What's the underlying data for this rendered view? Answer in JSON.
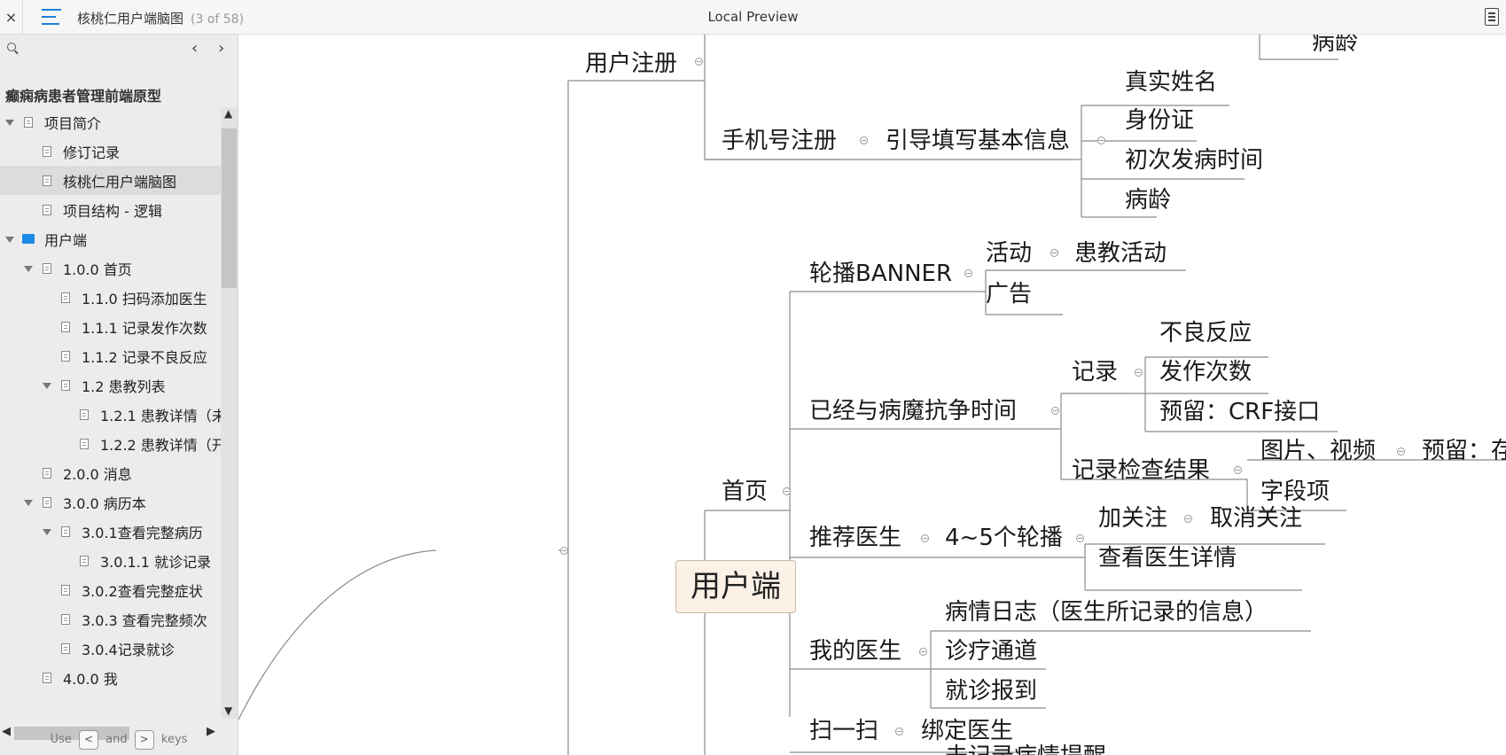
{
  "topbar": {
    "close_glyph": "×",
    "doc_title": "核桃仁用户端脑图",
    "doc_count": "(3 of 58)",
    "center_title": "Local Preview",
    "icons": [
      "close-icon",
      "toc-icon",
      "outline-icon"
    ]
  },
  "sidebar": {
    "project_title": "癫痫病患者管理前端原型",
    "nav_prev": "‹",
    "nav_next": "›",
    "items": [
      {
        "label": "项目简介"
      },
      {
        "label": "修订记录"
      },
      {
        "label": "核桃仁用户端脑图"
      },
      {
        "label": "项目结构 - 逻辑"
      },
      {
        "label": "用户端"
      },
      {
        "label": "1.0.0 首页"
      },
      {
        "label": "1.1.0 扫码添加医生"
      },
      {
        "label": "1.1.1 记录发作次数"
      },
      {
        "label": "1.1.2 记录不良反应"
      },
      {
        "label": "1.2 患教列表"
      },
      {
        "label": "1.2.1 患教详情（未"
      },
      {
        "label": "1.2.2 患教详情（开"
      },
      {
        "label": "2.0.0 消息"
      },
      {
        "label": "3.0.0 病历本"
      },
      {
        "label": "3.0.1查看完整病历"
      },
      {
        "label": "3.0.1.1 就诊记录"
      },
      {
        "label": "3.0.2查看完整症状"
      },
      {
        "label": "3.0.3 查看完整频次"
      },
      {
        "label": "3.0.4记录就诊"
      },
      {
        "label": "4.0.0 我"
      }
    ],
    "hint_use": "Use",
    "hint_and": "and",
    "hint_keys": "keys",
    "key_left": "<",
    "key_right": ">"
  },
  "mindmap": {
    "root": "用户端",
    "nodes": {
      "n1": "用户注册",
      "n2": "病龄",
      "n3": "手机号注册",
      "n4": "引导填写基本信息",
      "n5": "真实姓名",
      "n6": "身份证",
      "n7": "初次发病时间",
      "n8": "病龄",
      "n9": "首页",
      "n10": "轮播BANNER",
      "n11": "活动",
      "n12": "患教活动",
      "n13": "广告",
      "n14": "已经与病魔抗争时间",
      "n15": "记录",
      "n16": "不良反应",
      "n17": "发作次数",
      "n18": "预留：CRF接口",
      "n19": "记录检查结果",
      "n20": "图片、视频",
      "n21": "预留：存",
      "n22": "字段项",
      "n23": "推荐医生",
      "n24": "4~5个轮播",
      "n25": "加关注",
      "n26": "取消关注",
      "n27": "查看医生详情",
      "n28": "我的医生",
      "n29": "病情日志（医生所记录的信息）",
      "n30": "诊疗通道",
      "n31": "就诊报到",
      "n32": "扫一扫",
      "n33": "绑定医生",
      "n34": "未记录病情提醒"
    }
  }
}
